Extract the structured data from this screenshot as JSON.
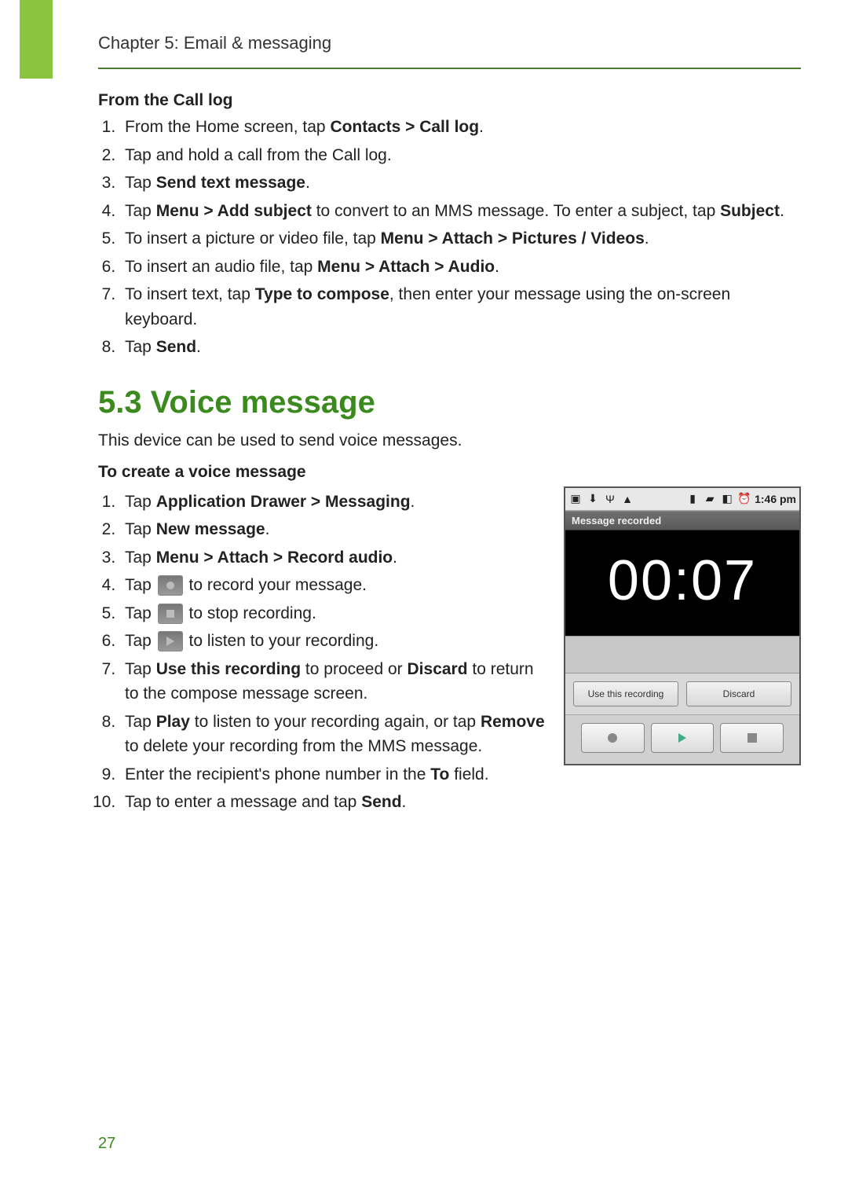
{
  "header": {
    "chapter_line": "Chapter 5: Email & messaging"
  },
  "section_a": {
    "heading": "From the Call log",
    "steps": [
      {
        "pre": "From the Home screen, tap ",
        "bold": "Contacts >  Call log",
        "post": "."
      },
      {
        "pre": "Tap and hold a call from the Call log.",
        "bold": "",
        "post": ""
      },
      {
        "pre": "Tap ",
        "bold": "Send text message",
        "post": "."
      },
      {
        "pre": "Tap ",
        "bold": "Menu >  Add subject",
        "post": " to convert to an MMS message. To enter a subject, tap ",
        "bold2": "Subject",
        "post2": "."
      },
      {
        "pre": "To insert a picture or video file, tap ",
        "bold": "Menu >  Attach >  Pictures / Videos",
        "post": "."
      },
      {
        "pre": "To insert an audio file, tap ",
        "bold": "Menu >  Attach >  Audio",
        "post": "."
      },
      {
        "pre": "To insert text, tap ",
        "bold": "Type to compose",
        "post": ", then enter your message using the on-screen keyboard."
      },
      {
        "pre": "Tap ",
        "bold": "Send",
        "post": "."
      }
    ]
  },
  "section_b": {
    "title": "5.3 Voice message",
    "intro": "This device can be used to send voice messages.",
    "subhead": "To create a voice message",
    "steps": [
      {
        "pre": "Tap ",
        "bold": "Application Drawer >  Messaging",
        "post": "."
      },
      {
        "pre": "Tap ",
        "bold": "New message",
        "post": "."
      },
      {
        "pre": "Tap ",
        "bold": "Menu >  Attach >  Record audio",
        "post": "."
      },
      {
        "pre": "Tap ",
        "icon": "record",
        "post": " to record your message."
      },
      {
        "pre": "Tap ",
        "icon": "stop",
        "post": " to stop recording."
      },
      {
        "pre": "Tap ",
        "icon": "play",
        "post": " to listen to your recording."
      },
      {
        "pre": "Tap ",
        "bold": "Use this recording",
        "post": " to proceed or ",
        "bold2": "Discard",
        "post2": " to return to the compose message screen."
      },
      {
        "pre": "Tap ",
        "bold": "Play",
        "post": " to listen to your recording again, or tap ",
        "bold2": "Remove",
        "post2": " to delete your recording from the MMS message."
      },
      {
        "pre": "Enter the recipient's phone number in the ",
        "bold": "To",
        "post": " field."
      },
      {
        "pre": "Tap to enter a message and tap ",
        "bold": "Send",
        "post": "."
      }
    ]
  },
  "phone": {
    "time": "1:46 pm",
    "title": "Message recorded",
    "timer": "00:07",
    "btn_use": "Use this recording",
    "btn_discard": "Discard"
  },
  "page_number": "27"
}
